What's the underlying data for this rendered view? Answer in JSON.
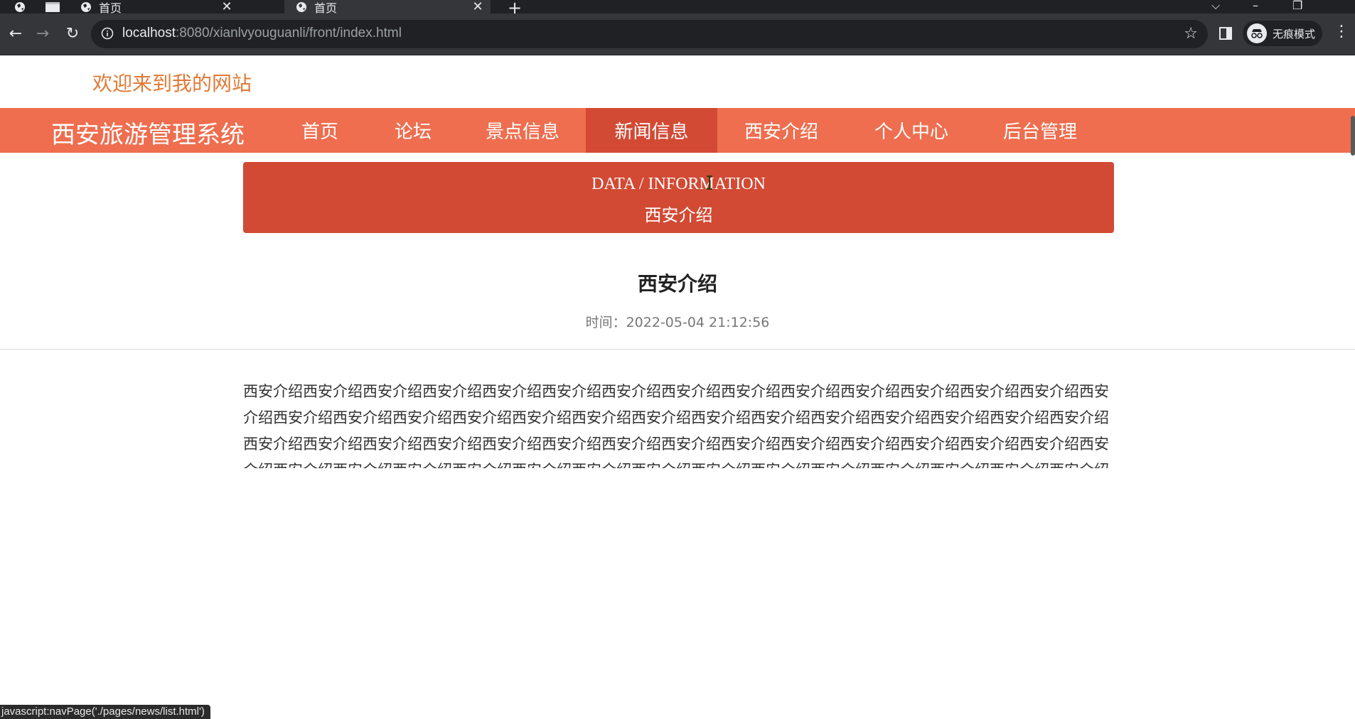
{
  "browser": {
    "tabs": [
      {
        "title": "首页",
        "active": false
      },
      {
        "title": "首页",
        "active": true
      }
    ],
    "new_tab_symbol": "+",
    "url_host": "localhost",
    "url_rest": ":8080/xianlvyouguanli/front/index.html",
    "incognito_label": "无痕模式",
    "status_text": "javascript:navPage('./pages/news/list.html')"
  },
  "site": {
    "welcome": "欢迎来到我的网站",
    "brand": "西安旅游管理系统",
    "nav": [
      "首页",
      "论坛",
      "景点信息",
      "新闻信息",
      "西安介绍",
      "个人中心",
      "后台管理"
    ],
    "active_nav_index": 3,
    "accent_color": "#ee6e4f",
    "accent_dark_color": "#d24a34"
  },
  "banner": {
    "english": "DATA / INFORMATION",
    "chinese": "西安介绍"
  },
  "article": {
    "title": "西安介绍",
    "time": "时间：2022-05-04 21:12:56",
    "body": "西安介绍西安介绍西安介绍西安介绍西安介绍西安介绍西安介绍西安介绍西安介绍西安介绍西安介绍西安介绍西安介绍西安介绍西安介绍西安介绍西安介绍西安介绍西安介绍西安介绍西安介绍西安介绍西安介绍西安介绍西安介绍西安介绍西安介绍西安介绍西安介绍西安介绍西安介绍西安介绍西安介绍西安介绍西安介绍西安介绍西安介绍西安介绍西安介绍西安介绍西安介绍西安介绍西安介绍西安介绍西安介绍西安介绍西安介绍西安介绍西安介绍西安介绍西安介绍西安介绍西安介绍西安介绍西安介绍西安介绍西安介绍西安介绍西安介绍西安介绍西安介绍西安介绍西安介绍"
  }
}
